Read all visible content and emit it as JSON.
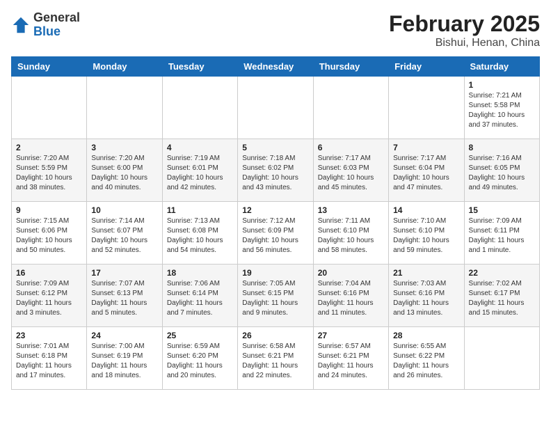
{
  "header": {
    "logo_line1": "General",
    "logo_line2": "Blue",
    "title": "February 2025",
    "subtitle": "Bishui, Henan, China"
  },
  "weekdays": [
    "Sunday",
    "Monday",
    "Tuesday",
    "Wednesday",
    "Thursday",
    "Friday",
    "Saturday"
  ],
  "weeks": [
    [
      {
        "day": "",
        "info": ""
      },
      {
        "day": "",
        "info": ""
      },
      {
        "day": "",
        "info": ""
      },
      {
        "day": "",
        "info": ""
      },
      {
        "day": "",
        "info": ""
      },
      {
        "day": "",
        "info": ""
      },
      {
        "day": "1",
        "info": "Sunrise: 7:21 AM\nSunset: 5:58 PM\nDaylight: 10 hours and 37 minutes."
      }
    ],
    [
      {
        "day": "2",
        "info": "Sunrise: 7:20 AM\nSunset: 5:59 PM\nDaylight: 10 hours and 38 minutes."
      },
      {
        "day": "3",
        "info": "Sunrise: 7:20 AM\nSunset: 6:00 PM\nDaylight: 10 hours and 40 minutes."
      },
      {
        "day": "4",
        "info": "Sunrise: 7:19 AM\nSunset: 6:01 PM\nDaylight: 10 hours and 42 minutes."
      },
      {
        "day": "5",
        "info": "Sunrise: 7:18 AM\nSunset: 6:02 PM\nDaylight: 10 hours and 43 minutes."
      },
      {
        "day": "6",
        "info": "Sunrise: 7:17 AM\nSunset: 6:03 PM\nDaylight: 10 hours and 45 minutes."
      },
      {
        "day": "7",
        "info": "Sunrise: 7:17 AM\nSunset: 6:04 PM\nDaylight: 10 hours and 47 minutes."
      },
      {
        "day": "8",
        "info": "Sunrise: 7:16 AM\nSunset: 6:05 PM\nDaylight: 10 hours and 49 minutes."
      }
    ],
    [
      {
        "day": "9",
        "info": "Sunrise: 7:15 AM\nSunset: 6:06 PM\nDaylight: 10 hours and 50 minutes."
      },
      {
        "day": "10",
        "info": "Sunrise: 7:14 AM\nSunset: 6:07 PM\nDaylight: 10 hours and 52 minutes."
      },
      {
        "day": "11",
        "info": "Sunrise: 7:13 AM\nSunset: 6:08 PM\nDaylight: 10 hours and 54 minutes."
      },
      {
        "day": "12",
        "info": "Sunrise: 7:12 AM\nSunset: 6:09 PM\nDaylight: 10 hours and 56 minutes."
      },
      {
        "day": "13",
        "info": "Sunrise: 7:11 AM\nSunset: 6:10 PM\nDaylight: 10 hours and 58 minutes."
      },
      {
        "day": "14",
        "info": "Sunrise: 7:10 AM\nSunset: 6:10 PM\nDaylight: 10 hours and 59 minutes."
      },
      {
        "day": "15",
        "info": "Sunrise: 7:09 AM\nSunset: 6:11 PM\nDaylight: 11 hours and 1 minute."
      }
    ],
    [
      {
        "day": "16",
        "info": "Sunrise: 7:09 AM\nSunset: 6:12 PM\nDaylight: 11 hours and 3 minutes."
      },
      {
        "day": "17",
        "info": "Sunrise: 7:07 AM\nSunset: 6:13 PM\nDaylight: 11 hours and 5 minutes."
      },
      {
        "day": "18",
        "info": "Sunrise: 7:06 AM\nSunset: 6:14 PM\nDaylight: 11 hours and 7 minutes."
      },
      {
        "day": "19",
        "info": "Sunrise: 7:05 AM\nSunset: 6:15 PM\nDaylight: 11 hours and 9 minutes."
      },
      {
        "day": "20",
        "info": "Sunrise: 7:04 AM\nSunset: 6:16 PM\nDaylight: 11 hours and 11 minutes."
      },
      {
        "day": "21",
        "info": "Sunrise: 7:03 AM\nSunset: 6:16 PM\nDaylight: 11 hours and 13 minutes."
      },
      {
        "day": "22",
        "info": "Sunrise: 7:02 AM\nSunset: 6:17 PM\nDaylight: 11 hours and 15 minutes."
      }
    ],
    [
      {
        "day": "23",
        "info": "Sunrise: 7:01 AM\nSunset: 6:18 PM\nDaylight: 11 hours and 17 minutes."
      },
      {
        "day": "24",
        "info": "Sunrise: 7:00 AM\nSunset: 6:19 PM\nDaylight: 11 hours and 18 minutes."
      },
      {
        "day": "25",
        "info": "Sunrise: 6:59 AM\nSunset: 6:20 PM\nDaylight: 11 hours and 20 minutes."
      },
      {
        "day": "26",
        "info": "Sunrise: 6:58 AM\nSunset: 6:21 PM\nDaylight: 11 hours and 22 minutes."
      },
      {
        "day": "27",
        "info": "Sunrise: 6:57 AM\nSunset: 6:21 PM\nDaylight: 11 hours and 24 minutes."
      },
      {
        "day": "28",
        "info": "Sunrise: 6:55 AM\nSunset: 6:22 PM\nDaylight: 11 hours and 26 minutes."
      },
      {
        "day": "",
        "info": ""
      }
    ]
  ]
}
